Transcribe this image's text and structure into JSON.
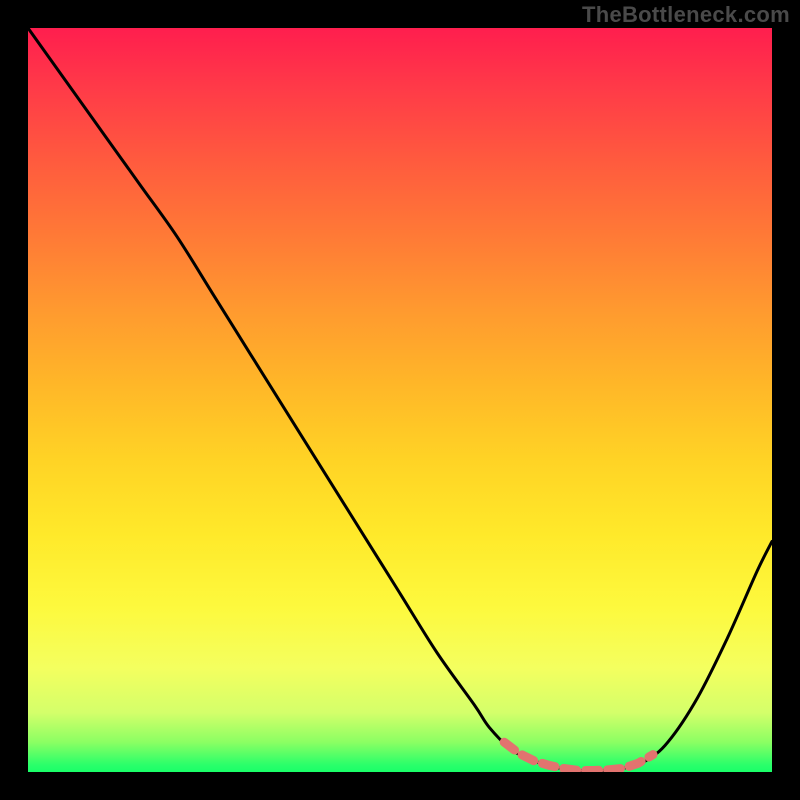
{
  "watermark": "TheBottleneck.com",
  "colors": {
    "page_bg": "#000000",
    "curve": "#000000",
    "flat_region_marker": "#e2736f",
    "watermark_text": "#4a4a4a",
    "gradient_top": "#ff1e4e",
    "gradient_mid": "#ffe92a",
    "gradient_bottom": "#19ff69"
  },
  "chart_data": {
    "type": "line",
    "title": "",
    "xlabel": "",
    "ylabel": "",
    "xlim": [
      0,
      100
    ],
    "ylim": [
      0,
      100
    ],
    "grid": false,
    "legend": false,
    "series": [
      {
        "name": "bottleneck-curve",
        "x": [
          0,
          5,
          10,
          15,
          20,
          25,
          30,
          35,
          40,
          45,
          50,
          55,
          60,
          62,
          65,
          68,
          71,
          74,
          77,
          80,
          83,
          86,
          90,
          94,
          98,
          100
        ],
        "values": [
          100,
          93,
          86,
          79,
          72,
          64,
          56,
          48,
          40,
          32,
          24,
          16,
          9,
          6,
          3,
          1.5,
          0.6,
          0.2,
          0.2,
          0.5,
          1.5,
          4,
          10,
          18,
          27,
          31
        ]
      }
    ],
    "annotations": [
      {
        "name": "optimal-flat-region",
        "x_start": 64,
        "x_end": 84,
        "y": 0.3
      }
    ],
    "background": "vertical-gradient-red-to-green"
  }
}
